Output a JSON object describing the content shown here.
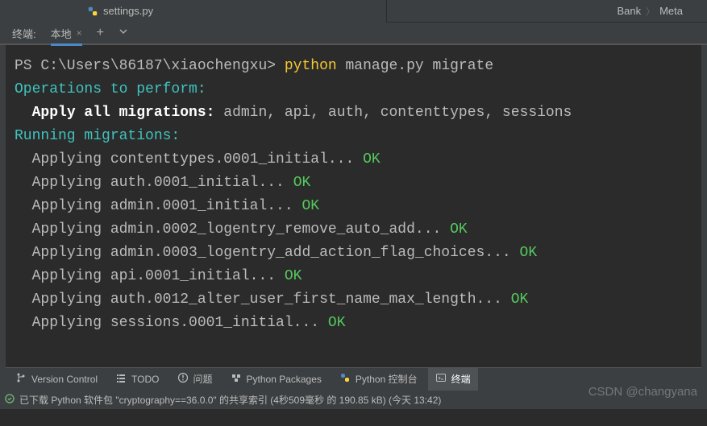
{
  "editor": {
    "file_tab": "settings.py",
    "breadcrumb": [
      "Bank",
      "Meta"
    ]
  },
  "terminal_panel": {
    "title": "终端:",
    "tab_label": "本地"
  },
  "terminal": {
    "prompt": "PS C:\\Users\\86187\\xiaochengxu>",
    "command_bin": "python",
    "command_args": "manage.py migrate",
    "heading_ops": "Operations to perform:",
    "apply_all_label": "Apply all migrations:",
    "apply_all_targets": "admin, api, auth, contenttypes, sessions",
    "heading_running": "Running migrations:",
    "lines": [
      {
        "text": "Applying contenttypes.0001_initial...",
        "ok": "OK"
      },
      {
        "text": "Applying auth.0001_initial...",
        "ok": "OK"
      },
      {
        "text": "Applying admin.0001_initial...",
        "ok": "OK"
      },
      {
        "text": "Applying admin.0002_logentry_remove_auto_add...",
        "ok": "OK"
      },
      {
        "text": "Applying admin.0003_logentry_add_action_flag_choices...",
        "ok": "OK"
      },
      {
        "text": "Applying api.0001_initial...",
        "ok": "OK"
      },
      {
        "text": "Applying auth.0012_alter_user_first_name_max_length...",
        "ok": "OK"
      },
      {
        "text": "Applying sessions.0001_initial...",
        "ok": "OK"
      }
    ]
  },
  "bottom_toolbar": {
    "items": [
      {
        "label": "Version Control",
        "icon": "branch-icon"
      },
      {
        "label": "TODO",
        "icon": "list-icon"
      },
      {
        "label": "问题",
        "icon": "warning-icon"
      },
      {
        "label": "Python Packages",
        "icon": "packages-icon"
      },
      {
        "label": "Python 控制台",
        "icon": "python-icon"
      },
      {
        "label": "终端",
        "icon": "terminal-icon",
        "active": true
      }
    ]
  },
  "status_bar": {
    "text": "已下载 Python 软件包 \"cryptography==36.0.0\" 的共享索引 (4秒509毫秒 的 190.85 kB) (今天 13:42)"
  },
  "watermark": "CSDN @changyana"
}
